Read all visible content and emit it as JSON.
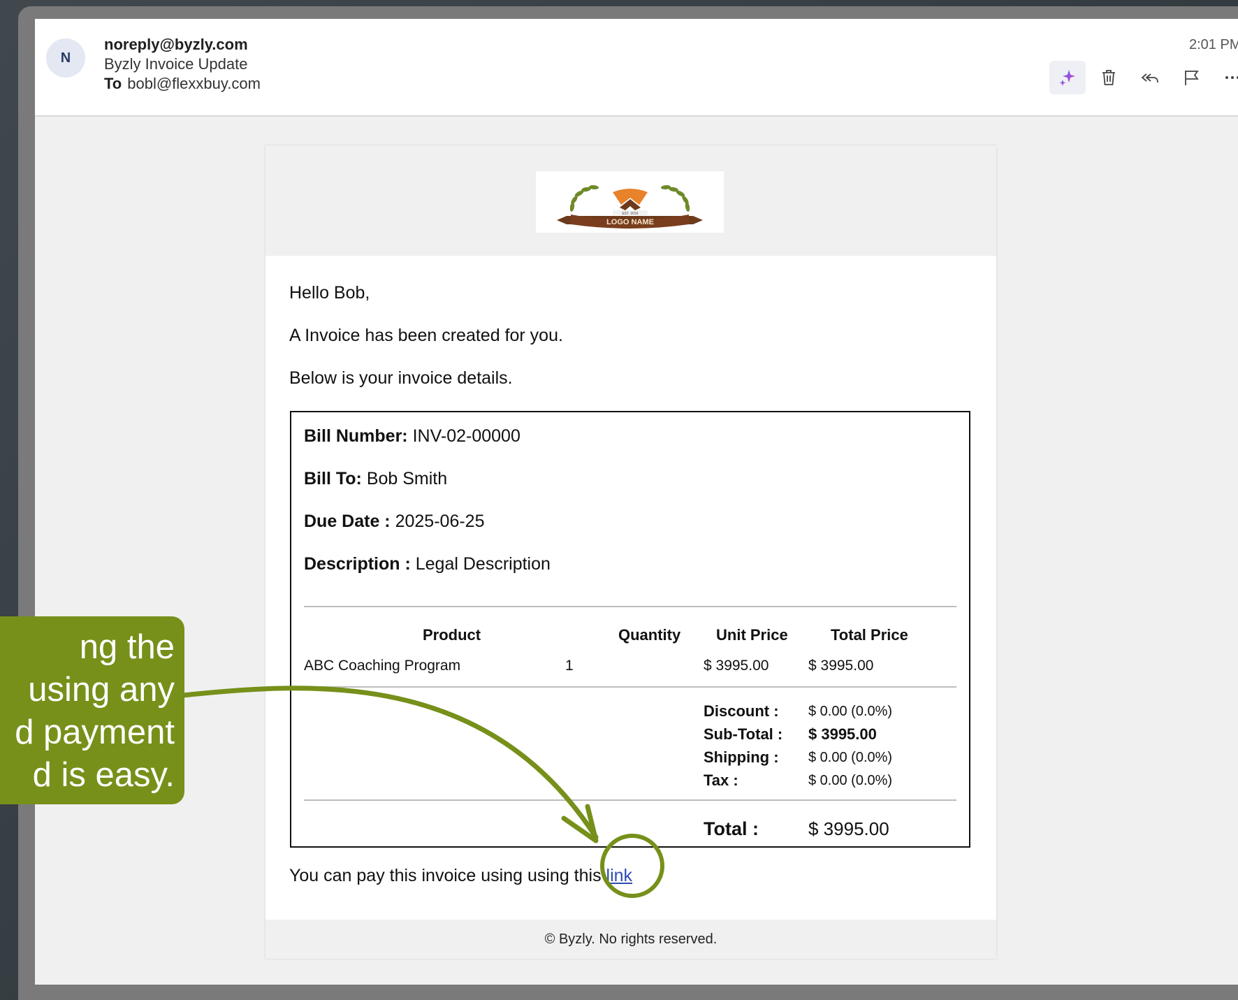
{
  "email": {
    "avatar_initial": "N",
    "sender": "noreply@byzly.com",
    "subject": "Byzly Invoice Update",
    "to_label": "To",
    "to_address": "bobl@flexxbuy.com",
    "time": "2:01 PM",
    "actions": [
      "copilot-icon",
      "trash-icon",
      "reply-all-icon",
      "flag-icon",
      "more-icon"
    ]
  },
  "body": {
    "logo_text": "LOGO NAME",
    "logo_small_text": "EST. 2016",
    "greeting": "Hello Bob,",
    "line1": "A Invoice has been created for you.",
    "line2": "Below is your invoice details."
  },
  "invoice": {
    "bill_number_label": "Bill Number:",
    "bill_number": "INV-02-00000",
    "bill_to_label": "Bill To:",
    "bill_to": "Bob Smith",
    "due_date_label": "Due Date :",
    "due_date": "2025-06-25",
    "description_label": "Description :",
    "description": "Legal Description",
    "columns": [
      "Product",
      "Quantity",
      "Unit Price",
      "Total Price"
    ],
    "row": {
      "product": "ABC Coaching Program",
      "quantity": "1",
      "unit_price": "$ 3995.00",
      "total_price": "$ 3995.00"
    },
    "discount_label": "Discount :",
    "discount": "$ 0.00 (0.0%)",
    "subtotal_label": "Sub-Total :",
    "subtotal": "$ 3995.00",
    "shipping_label": "Shipping :",
    "shipping": "$ 0.00 (0.0%)",
    "tax_label": "Tax :",
    "tax": "$ 0.00 (0.0%)",
    "total_label": "Total :",
    "total": "$ 3995.00"
  },
  "pay": {
    "text": "You can pay this invoice using using this",
    "link": "link"
  },
  "footer": "© Byzly. No rights reserved.",
  "callout": {
    "lines": [
      "ng the",
      "using any",
      "d payment",
      "d is easy."
    ],
    "color": "#76901a"
  }
}
